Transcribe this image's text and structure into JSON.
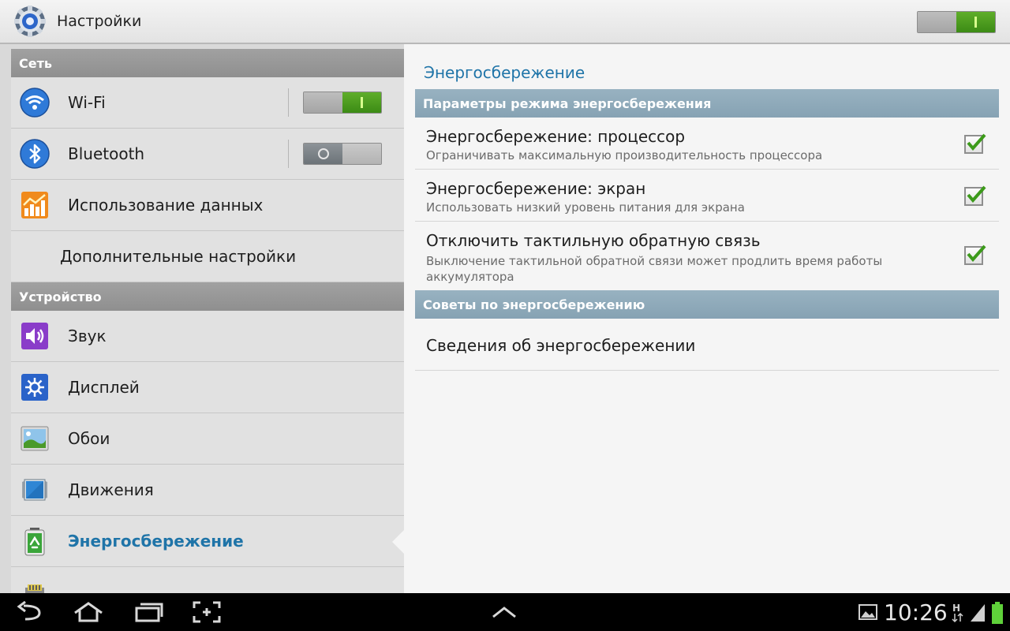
{
  "app": {
    "title": "Настройки",
    "icon": "gear-icon"
  },
  "master_switch": {
    "state": "on"
  },
  "sidebar": {
    "sections": [
      {
        "header": "Сеть"
      },
      {
        "header": "Устройство"
      }
    ],
    "items": [
      {
        "label": "Wi-Fi",
        "icon": "wifi-icon",
        "toggle": "on"
      },
      {
        "label": "Bluetooth",
        "icon": "bluetooth-icon",
        "toggle": "off"
      },
      {
        "label": "Использование данных",
        "icon": "data-usage-icon"
      },
      {
        "label": "Дополнительные настройки"
      },
      {
        "label": "Звук",
        "icon": "sound-icon"
      },
      {
        "label": "Дисплей",
        "icon": "display-icon"
      },
      {
        "label": "Обои",
        "icon": "wallpaper-icon"
      },
      {
        "label": "Движения",
        "icon": "motion-icon"
      },
      {
        "label": "Энергосбережение",
        "icon": "power-saving-icon",
        "selected": true
      },
      {
        "label": "",
        "icon": "storage-icon"
      }
    ]
  },
  "detail": {
    "title": "Энергосбережение",
    "section1": "Параметры режима энергосбережения",
    "prefs": [
      {
        "title": "Энергосбережение: процессор",
        "summary": "Ограничивать максимальную производительность процессора",
        "checked": true
      },
      {
        "title": "Энергосбережение: экран",
        "summary": "Использовать низкий уровень питания для экрана",
        "checked": true
      },
      {
        "title": "Отключить тактильную обратную связь",
        "summary": "Выключение тактильной обратной связи может продлить время работы аккумулятора",
        "checked": true
      }
    ],
    "section2": "Советы по энергосбережению",
    "info_item": "Сведения об энергосбережении"
  },
  "system_bar": {
    "time": "10:26",
    "buttons": [
      "back-icon",
      "home-icon",
      "recent-apps-icon",
      "screenshot-icon",
      "up-arrow-icon"
    ],
    "status_icons": [
      "gallery-notification-icon",
      "network-h-icon",
      "signal-icon"
    ]
  },
  "colors": {
    "accent": "#1f74a8",
    "toggle_on": "#4a9a1f",
    "section_header_left": "#969696",
    "section_header_right": "#8fa9b9"
  }
}
